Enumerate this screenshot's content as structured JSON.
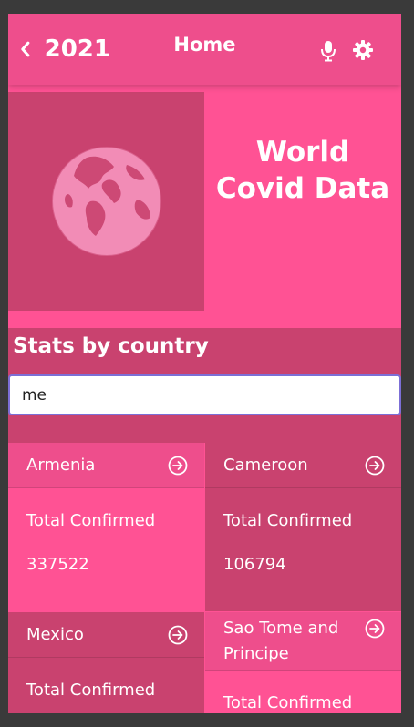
{
  "header": {
    "back_label": "2021",
    "title": "Home"
  },
  "banner": {
    "title": "World Covid Data"
  },
  "stats": {
    "heading": "Stats by country",
    "search_value": "me"
  },
  "cards": [
    {
      "country": "Armenia",
      "label": "Total Confirmed",
      "value": "337522"
    },
    {
      "country": "Cameroon",
      "label": "Total Confirmed",
      "value": "106794"
    },
    {
      "country": "Mexico",
      "label": "Total Confirmed",
      "value": ""
    },
    {
      "country": "Sao Tome and Principe",
      "label": "Total Confirmed",
      "value": ""
    }
  ],
  "colors": {
    "accent": "#ff5294",
    "dark": "#c9426f",
    "header": "#ee4e8c"
  },
  "icons": {
    "back": "chevron-left-icon",
    "mic": "microphone-icon",
    "settings": "gear-icon",
    "globe": "globe-icon",
    "arrow": "arrow-circle-right-icon"
  }
}
